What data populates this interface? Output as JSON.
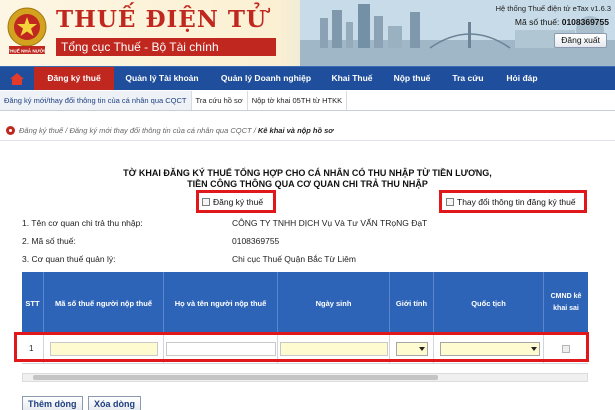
{
  "header": {
    "title": "THUẾ ĐIỆN TỬ",
    "subtitle": "Tổng cục Thuế - Bộ Tài chính",
    "emblem_text": "THUẾ NHÀ NƯỚC",
    "system_version": "Hệ thống Thuế điện tử eTax v1.6.3",
    "tax_id_label": "Mã số thuế:",
    "tax_id_value": "0108369755",
    "logout_label": "Đăng xuất"
  },
  "main_nav": {
    "home_icon": "home-icon",
    "items": [
      {
        "label": "Đăng ký thuế",
        "active": true
      },
      {
        "label": "Quản lý Tài khoản",
        "active": false
      },
      {
        "label": "Quản lý Doanh nghiệp",
        "active": false
      },
      {
        "label": "Khai Thuế",
        "active": false
      },
      {
        "label": "Nộp thuế",
        "active": false
      },
      {
        "label": "Tra cứu",
        "active": false
      },
      {
        "label": "Hỏi đáp",
        "active": false
      }
    ]
  },
  "sub_nav": {
    "items": [
      {
        "label": "Đăng ký mới/thay đổi thông tin của cá nhân qua CQCT",
        "active": true
      },
      {
        "label": "Tra cứu hồ sơ",
        "active": false
      },
      {
        "label": "Nộp tờ khai 05TH từ HTKK",
        "active": false
      }
    ]
  },
  "breadcrumb": {
    "parts": [
      "Đăng ký thuế",
      "Đăng ký mới thay đổi thông tin của cá nhân qua CQCT"
    ],
    "separator": " / ",
    "current": "Kê khai và nộp hồ sơ"
  },
  "form": {
    "title_line1": "TỜ KHAI ĐĂNG KÝ THUẾ TỔNG HỢP CHO CÁ NHÂN CÓ THU NHẬP TỪ TIỀN LƯƠNG,",
    "title_line2": "TIỀN CÔNG THÔNG QUA CƠ QUAN CHI TRẢ THU NHẬP",
    "checkbox_register": {
      "label": "Đăng ký thuế",
      "checked": false
    },
    "checkbox_change": {
      "label": "Thay đổi thông tin đăng ký thuế",
      "checked": false
    },
    "fields": [
      {
        "label": "1. Tên cơ quan chi trả thu nhập:",
        "value": "CÔNG TY TNHH DỊCH Vụ Và Tư VẤN TRọNG ĐạT"
      },
      {
        "label": "2. Mã số thuế:",
        "value": "0108369755"
      },
      {
        "label": "3. Cơ quan thuế quản lý:",
        "value": "Chi cục Thuế Quận Bắc Từ Liêm"
      }
    ]
  },
  "grid": {
    "columns": [
      "STT",
      "Mã số thuế người nộp thuế",
      "Họ và tên người nộp thuế",
      "Ngày sinh",
      "Giới tính",
      "Quốc tịch",
      "CMND kê khai sai"
    ],
    "rows": [
      {
        "stt": "1",
        "ma_so_thue": "",
        "ho_ten": "",
        "ngay_sinh": "",
        "gioi_tinh": "",
        "quoc_tich": "",
        "cmnd_ke_khai_sai": false
      }
    ]
  },
  "actions": {
    "add_row": "Thêm dòng",
    "delete_row": "Xóa dòng"
  },
  "colors": {
    "brand_red": "#c0271e",
    "nav_blue": "#1f4e9c",
    "grid_header_blue": "#2e64b8",
    "highlight_red": "#e0171b",
    "input_yellow": "#fffbd0"
  }
}
